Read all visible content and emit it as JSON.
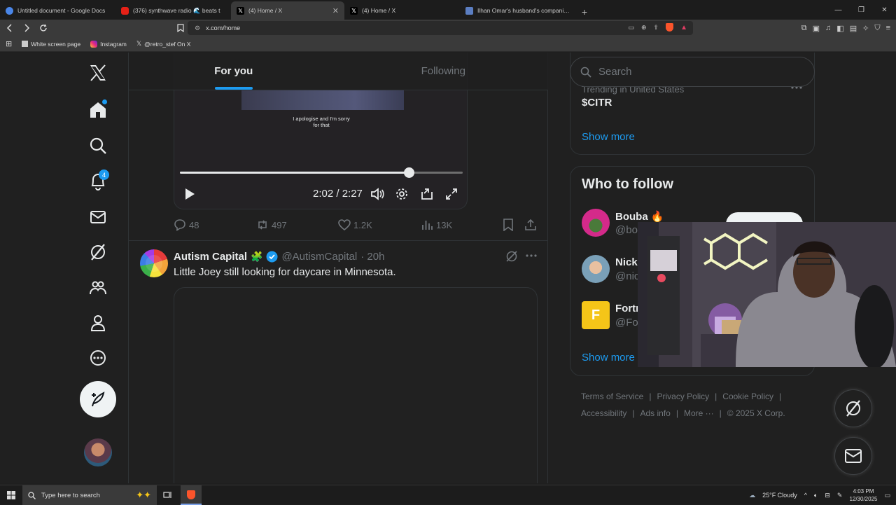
{
  "browser": {
    "tabs": [
      {
        "title": "Untitled document - Google Docs",
        "icon": "docs-icon"
      },
      {
        "title": "(376) synthwave radio 🌊 beats t",
        "icon": "youtube-icon"
      },
      {
        "title": "(4) Home / X",
        "icon": "x-icon",
        "active": true
      },
      {
        "title": "(4) Home / X",
        "icon": "x-icon"
      },
      {
        "title": "Ilhan Omar's husband's companies s",
        "icon": "news-icon"
      }
    ],
    "new_tab": "+",
    "url": "x.com/home",
    "bookmarks": [
      "White screen page",
      "Instagram",
      "@retro_stef On X"
    ]
  },
  "left_nav": {
    "notification_count": "4"
  },
  "feed": {
    "tabs": [
      "For you",
      "Following"
    ],
    "video": {
      "caption_line1": "I apologise and I'm sorry",
      "caption_line2": "for that",
      "time": "2:02 / 2:27",
      "progress": 0.81
    },
    "actions": {
      "replies": "48",
      "reposts": "497",
      "likes": "1.2K",
      "views": "13K"
    },
    "post": {
      "name": "Autism Capital",
      "name_emoji": "🧩",
      "handle": "@AutismCapital",
      "time": "· 20h",
      "text": "Little Joey still looking for daycare in Minnesota."
    }
  },
  "sidebar": {
    "search_placeholder": "Search",
    "trend_context": "Trending in United States",
    "trend_name": "$CITR",
    "show_more": "Show more",
    "who_to_follow_title": "Who to follow",
    "follow_rows": [
      {
        "name": "Bouba 🔥",
        "handle": "@bo"
      },
      {
        "name": "Nick",
        "handle": "@nic"
      },
      {
        "name": "Fortn",
        "handle": "@For"
      }
    ],
    "show_more_2": "Show more",
    "footer_row1": [
      "Terms of Service",
      "Privacy Policy",
      "Cookie Policy"
    ],
    "footer_row2": [
      "Accessibility",
      "Ads info",
      "More ···",
      "© 2025 X Corp."
    ]
  },
  "taskbar": {
    "search_placeholder": "Type here to search",
    "weather": "25°F  Cloudy",
    "time": "4:03 PM",
    "date": "12/30/2025"
  },
  "colors": {
    "accent": "#1d9bf0",
    "background": "#202020",
    "text": "#e7e9ea",
    "muted": "#71767b"
  }
}
